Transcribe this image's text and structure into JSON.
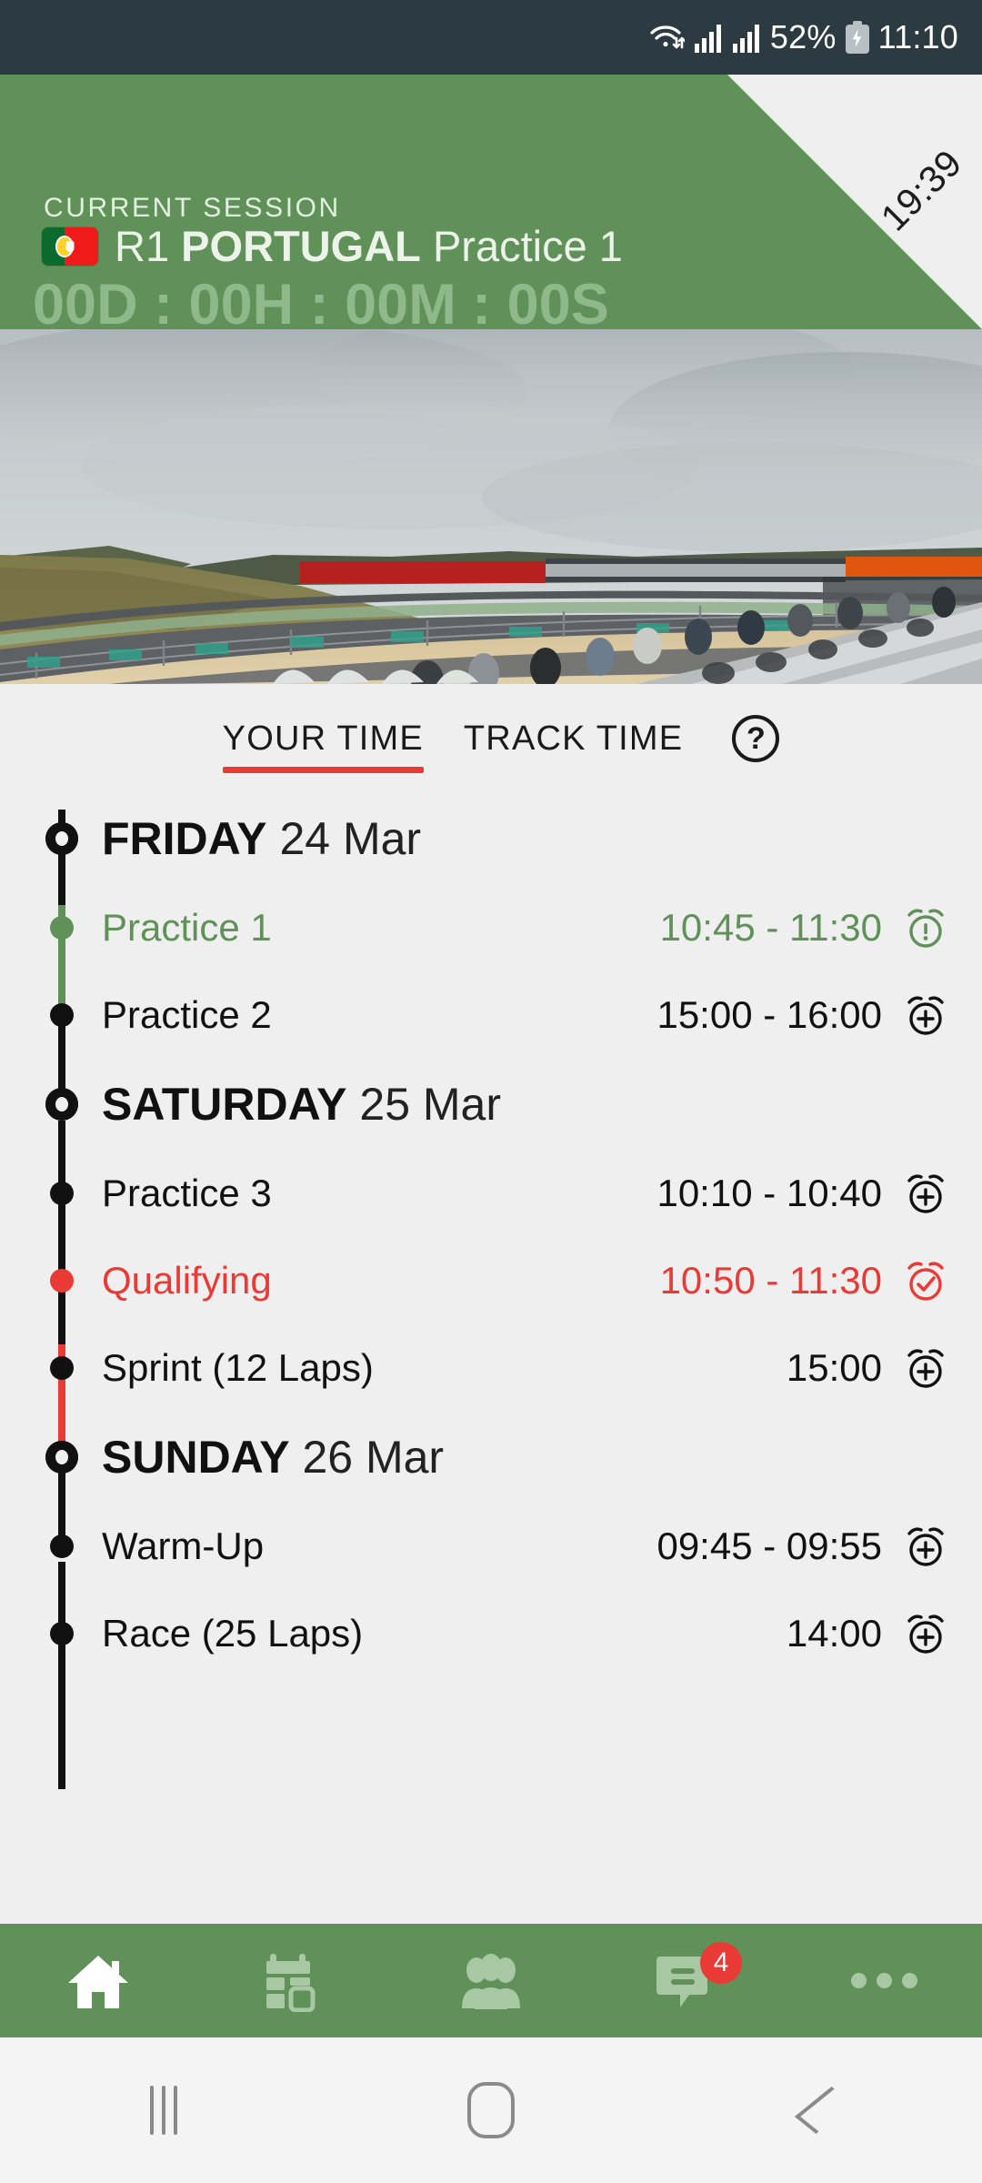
{
  "status_bar": {
    "wifi_icon": "wifi-icon",
    "signal_icon_1": "signal-bars-icon",
    "signal_icon_2": "signal-bars-icon",
    "battery_percent": "52%",
    "battery_icon": "battery-charging-icon",
    "clock": "11:10"
  },
  "header": {
    "accent_green": "#5f9159",
    "session_label": "CURRENT SESSION",
    "flag_icon": "portugal-flag-icon",
    "round": "R1",
    "country": "PORTUGAL",
    "session_name": "Practice 1",
    "countdown": "00D : 00H : 00M : 00S",
    "corner_time": "19:39"
  },
  "hero": {
    "alt": "Portimao circuit grandstand view"
  },
  "tabs": {
    "items": [
      {
        "label": "YOUR TIME",
        "active": true
      },
      {
        "label": "TRACK TIME",
        "active": false
      }
    ],
    "help_icon": "help-circle-icon",
    "active_underline_color": "#e93a35"
  },
  "schedule": {
    "days": [
      {
        "weekday": "FRIDAY",
        "date": "24 Mar",
        "events": [
          {
            "name": "Practice 1",
            "time": "10:45 - 11:30",
            "state": "live",
            "alarm_icon": "alarm-alert-icon",
            "color": "#5f9159"
          },
          {
            "name": "Practice 2",
            "time": "15:00 - 16:00",
            "state": "default",
            "alarm_icon": "alarm-add-icon",
            "color": "#111111"
          }
        ]
      },
      {
        "weekday": "SATURDAY",
        "date": "25 Mar",
        "events": [
          {
            "name": "Practice 3",
            "time": "10:10 - 10:40",
            "state": "default",
            "alarm_icon": "alarm-add-icon",
            "color": "#111111"
          },
          {
            "name": "Qualifying",
            "time": "10:50 - 11:30",
            "state": "alarm-set",
            "alarm_icon": "alarm-check-icon",
            "color": "#e93a35"
          },
          {
            "name": "Sprint (12 Laps)",
            "time": "15:00",
            "state": "default",
            "alarm_icon": "alarm-add-icon",
            "color": "#111111"
          }
        ]
      },
      {
        "weekday": "SUNDAY",
        "date": "26 Mar",
        "events": [
          {
            "name": "Warm-Up",
            "time": "09:45 - 09:55",
            "state": "default",
            "alarm_icon": "alarm-add-icon",
            "color": "#111111"
          },
          {
            "name": "Race (25 Laps)",
            "time": "14:00",
            "state": "default",
            "alarm_icon": "alarm-add-icon",
            "color": "#111111"
          }
        ]
      }
    ]
  },
  "bottom_nav": {
    "background": "#5f9159",
    "items": [
      {
        "icon": "home-icon",
        "active": true,
        "badge": null
      },
      {
        "icon": "calendar-icon",
        "active": false,
        "badge": null
      },
      {
        "icon": "people-icon",
        "active": false,
        "badge": null
      },
      {
        "icon": "chat-icon",
        "active": false,
        "badge": "4"
      },
      {
        "icon": "more-horizontal-icon",
        "active": false,
        "badge": null
      }
    ],
    "badge_color": "#e93a35"
  },
  "android_nav": {
    "recents_icon": "recents-icon",
    "home_icon": "home-square-icon",
    "back_icon": "back-chevron-icon"
  }
}
